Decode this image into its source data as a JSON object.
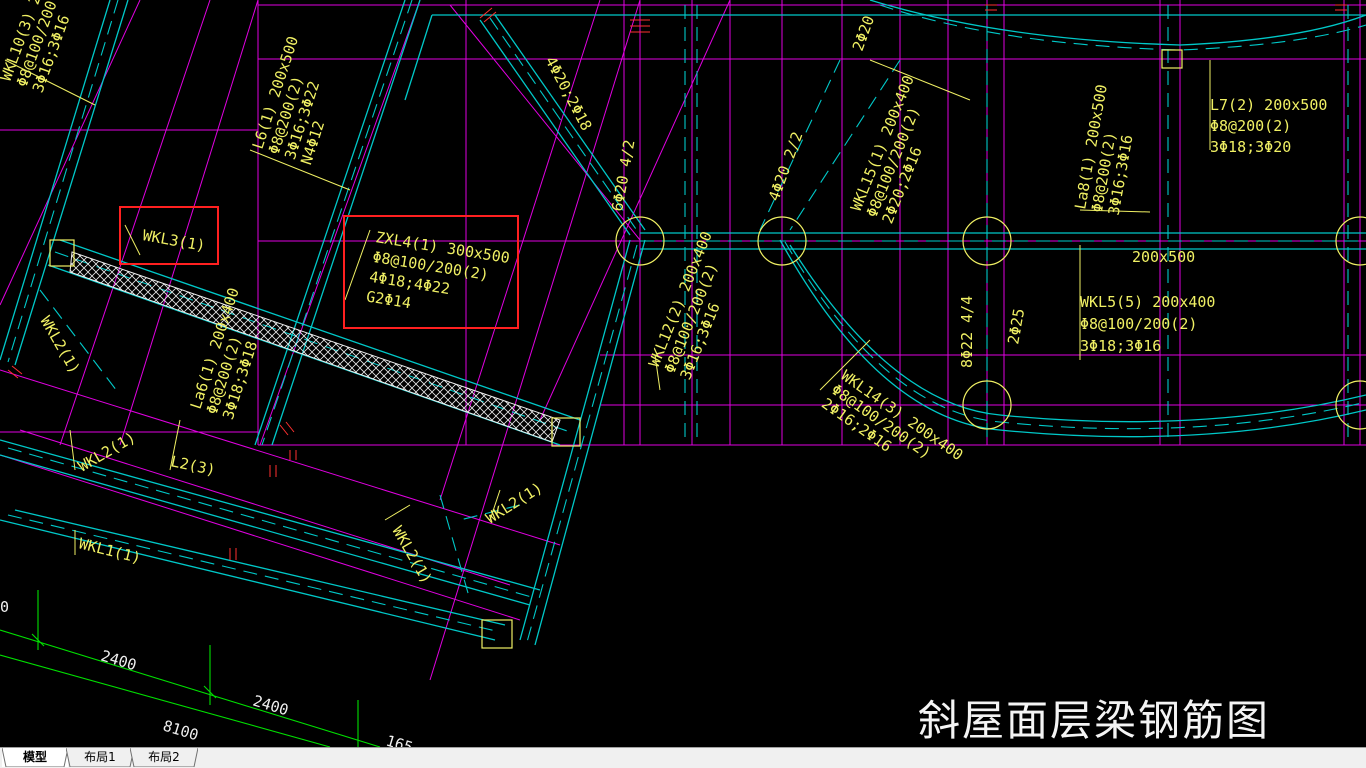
{
  "drawing": {
    "title": "斜屋面层梁钢筋图",
    "beam_labels": [
      {
        "id": "wkl10",
        "lines": [
          "WKL10(3) 2",
          "Φ8@100/200",
          "3Φ16;3Φ16"
        ]
      },
      {
        "id": "l6",
        "lines": [
          "L6(1) 200x500",
          "Φ8@200(2)",
          "3Φ16;3Φ22",
          "N4Φ12"
        ]
      },
      {
        "id": "diag-4-2",
        "lines": [
          "4Φ20;2Φ18"
        ]
      },
      {
        "id": "col-a-top",
        "lines": [
          "2Φ20"
        ]
      },
      {
        "id": "col-a-left",
        "lines": [
          "6Φ20 4/2"
        ]
      },
      {
        "id": "col-b-left",
        "lines": [
          "4Φ20 2/2"
        ]
      },
      {
        "id": "wkl15",
        "lines": [
          "WKL15(1) 200x400",
          "Φ8@100/200(2)",
          "2Φ20;2Φ16"
        ]
      },
      {
        "id": "la8",
        "lines": [
          "La8(1) 200x500",
          "Φ8@200(2)",
          "3Φ16;3Φ16"
        ]
      },
      {
        "id": "l7",
        "lines": [
          "L7(2) 200x500",
          "Φ8@200(2)",
          "3Φ18;3Φ20"
        ]
      },
      {
        "id": "wkl3",
        "lines": [
          "WKL3(1)"
        ]
      },
      {
        "id": "zxl4",
        "lines": [
          "ZXL4(1) 300x500",
          "Φ8@100/200(2)",
          "4Φ18;4Φ22",
          "G2Φ14"
        ]
      },
      {
        "id": "size-200x500",
        "lines": [
          "200x500"
        ]
      },
      {
        "id": "wkl5",
        "lines": [
          "WKL5(5) 200x400",
          "Φ8@100/200(2)",
          "3Φ18;3Φ16"
        ]
      },
      {
        "id": "wkl12",
        "lines": [
          "WKL12(2) 200x400",
          "Φ8@100/200(2)",
          "3Φ16;3Φ16"
        ]
      },
      {
        "id": "col-c-8-22",
        "lines": [
          "8Φ22 4/4"
        ]
      },
      {
        "id": "col-c-2-25",
        "lines": [
          "2Φ25"
        ]
      },
      {
        "id": "wkl14",
        "lines": [
          "WKL14(3) 200x400",
          "Φ8@100/200(2)",
          "2Φ16;2Φ16"
        ]
      },
      {
        "id": "la6",
        "lines": [
          "La6(1) 200x400",
          "Φ8@200(2)",
          "3Φ18;3Φ18"
        ]
      },
      {
        "id": "wkl2-left",
        "lines": [
          "WKL2(1)"
        ]
      },
      {
        "id": "wkl2-a",
        "lines": [
          "WKL2(1)"
        ]
      },
      {
        "id": "l2",
        "lines": [
          "L2(3)"
        ]
      },
      {
        "id": "wkl1",
        "lines": [
          "WKL1(1)"
        ]
      },
      {
        "id": "wkl2-b",
        "lines": [
          "WKL2(1)"
        ]
      },
      {
        "id": "wkl2-c",
        "lines": [
          "WKL2(1)"
        ]
      }
    ],
    "dimensions": [
      "2400",
      "2400",
      "8100",
      "0",
      "165"
    ],
    "colors": {
      "background": "#000000",
      "grid_magenta": "#e100e1",
      "beam_cyan": "#00c8c8",
      "text_yellow": "#f0f064",
      "dim_green": "#00e000",
      "highlight_red": "#ff2020",
      "title_white": "#f4f4f4"
    }
  },
  "tabs": [
    {
      "label": "模型",
      "active": true
    },
    {
      "label": "布局1",
      "active": false
    },
    {
      "label": "布局2",
      "active": false
    }
  ]
}
